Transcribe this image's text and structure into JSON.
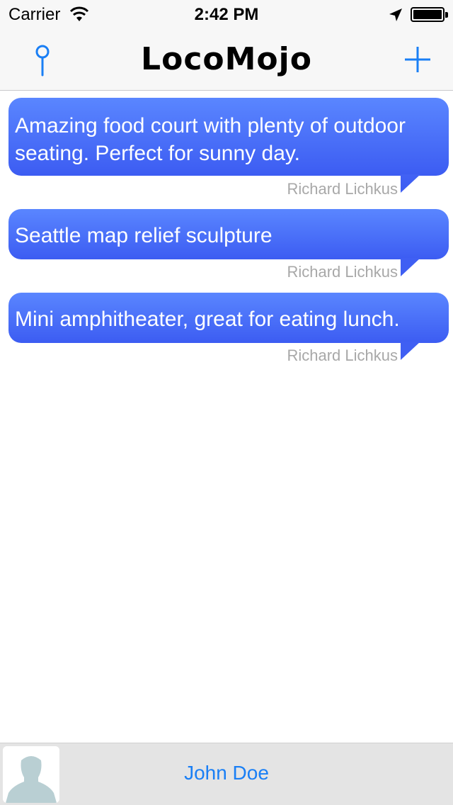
{
  "status_bar": {
    "carrier": "Carrier",
    "time": "2:42 PM"
  },
  "nav": {
    "title": "LocoMojo",
    "left_icon": "map-pin-icon",
    "right_icon": "plus-icon"
  },
  "posts": [
    {
      "text": "Amazing food court with plenty of outdoor seating. Perfect for sunny day.",
      "author": "Richard Lichkus"
    },
    {
      "text": "Seattle map relief sculpture",
      "author": "Richard Lichkus"
    },
    {
      "text": "Mini amphitheater, great for eating lunch.",
      "author": "Richard Lichkus"
    }
  ],
  "footer": {
    "user_name": "John Doe",
    "avatar_icon": "person-silhouette-icon"
  },
  "colors": {
    "accent": "#1a7ff5",
    "bubble_top": "#5a86ff",
    "bubble_bottom": "#3c5cf2",
    "author_text": "#a8a8a8"
  }
}
